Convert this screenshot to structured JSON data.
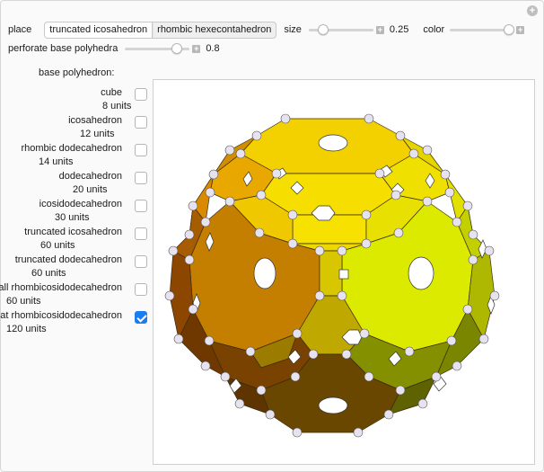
{
  "controls": {
    "place_label": "place",
    "place_options": [
      "truncated icosahedron",
      "rhombic hexecontahedron"
    ],
    "place_selected": "truncated icosahedron",
    "size_label": "size",
    "size_value": "0.25",
    "color_label": "color",
    "perforate_label": "perforate base polyhedra",
    "perforate_value": "0.8",
    "plus_icon": "+"
  },
  "base": {
    "title": "base polyhedron:",
    "options": [
      {
        "name": "cube",
        "units": "8 units",
        "checked": false
      },
      {
        "name": "icosahedron",
        "units": "12 units",
        "checked": false
      },
      {
        "name": "rhombic dodecahedron",
        "units": "14 units",
        "checked": false
      },
      {
        "name": "dodecahedron",
        "units": "20 units",
        "checked": false
      },
      {
        "name": "icosidodecahedron",
        "units": "30 units",
        "checked": false
      },
      {
        "name": "truncated icosahedron",
        "units": "60 units",
        "checked": false
      },
      {
        "name": "truncated dodecahedron",
        "units": "60 units",
        "checked": false
      },
      {
        "name": "small rhombicosidodecahedron",
        "units": "60 units",
        "checked": false
      },
      {
        "name": "great rhombicosidodecahedron",
        "units": "120 units",
        "checked": true
      }
    ]
  }
}
